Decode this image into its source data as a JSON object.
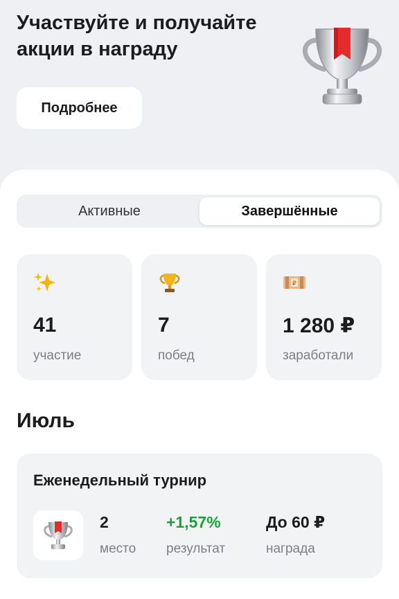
{
  "hero": {
    "title": "Участвуйте и получайте акции в награду",
    "more_button": "Подробнее",
    "trophy_icon": "silver-trophy-with-red-ribbon-icon"
  },
  "tabs": [
    {
      "label": "Активные",
      "active": false
    },
    {
      "label": "Завершённые",
      "active": true
    }
  ],
  "stats": [
    {
      "icon": "sparkles-icon",
      "value": "41",
      "label": "участие"
    },
    {
      "icon": "trophy-icon",
      "value": "7",
      "label": "побед"
    },
    {
      "icon": "money-icon",
      "value": "1 280 ₽",
      "label": "заработали"
    }
  ],
  "month": "Июль",
  "tournament": {
    "title": "Еженедельный турнир",
    "icon": "silver-trophy-icon",
    "place_value": "2",
    "place_label": "место",
    "result_value": "+1,57%",
    "result_label": "результат",
    "reward_value": "До 60 ₽",
    "reward_label": "награда"
  },
  "colors": {
    "background": "#eef0f3",
    "card": "#f2f3f5",
    "positive": "#1f9e3c",
    "ribbon": "#e52b2b"
  }
}
